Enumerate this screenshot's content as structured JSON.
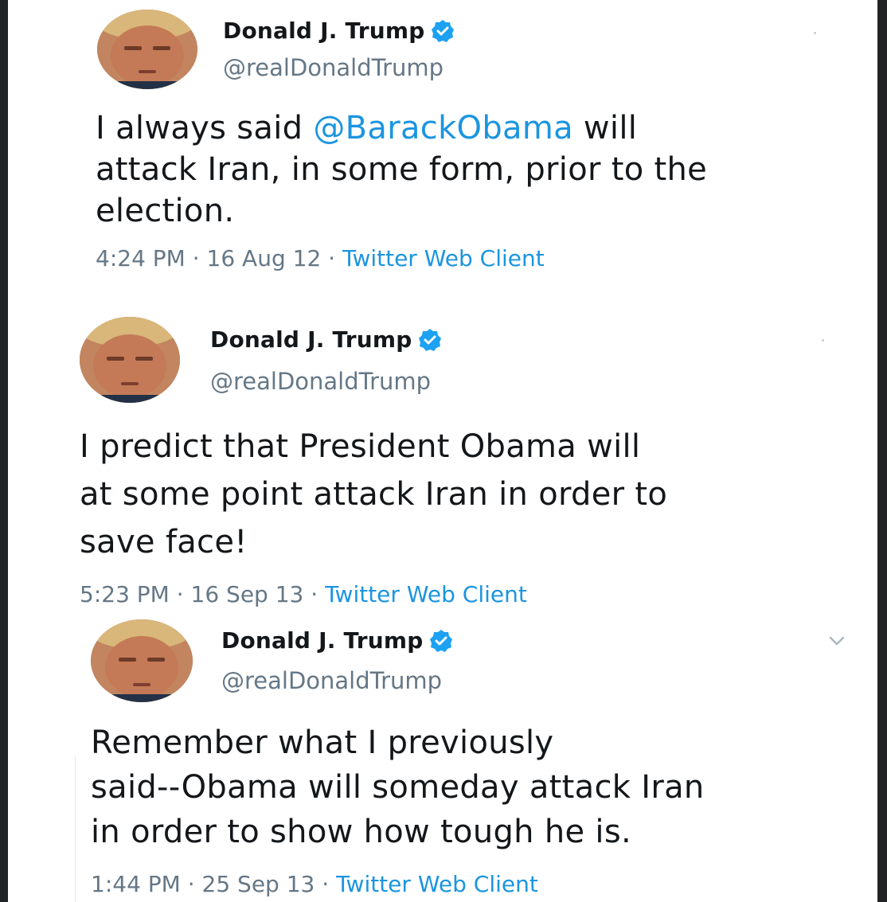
{
  "tweets": [
    {
      "author": {
        "name": "Donald J. Trump",
        "handle": "@realDonaldTrump",
        "avatar_icon": "profile-photo",
        "verified_icon": "verified-badge-icon"
      },
      "lines": [
        {
          "before": "I always said ",
          "mention": "@BarackObama",
          "after": " will"
        },
        {
          "before": "attack Iran, in some form, prior to the",
          "mention": "",
          "after": ""
        },
        {
          "before": "election.",
          "mention": "",
          "after": ""
        }
      ],
      "time": "4:24 PM",
      "date": "16 Aug 12",
      "separator": " · ",
      "source": "Twitter Web Client"
    },
    {
      "author": {
        "name": "Donald J. Trump",
        "handle": "@realDonaldTrump",
        "avatar_icon": "profile-photo",
        "verified_icon": "verified-badge-icon"
      },
      "lines": [
        {
          "before": "I predict that President Obama will",
          "mention": "",
          "after": ""
        },
        {
          "before": "at some point attack Iran in order to",
          "mention": "",
          "after": ""
        },
        {
          "before": "save face!",
          "mention": "",
          "after": ""
        }
      ],
      "time": "5:23 PM",
      "date": "16 Sep 13",
      "separator": " · ",
      "source": "Twitter Web Client"
    },
    {
      "author": {
        "name": "Donald J. Trump",
        "handle": "@realDonaldTrump",
        "avatar_icon": "profile-photo",
        "verified_icon": "verified-badge-icon"
      },
      "lines": [
        {
          "before": "Remember what I previously",
          "mention": "",
          "after": ""
        },
        {
          "before": "said--Obama will someday attack Iran",
          "mention": "",
          "after": ""
        },
        {
          "before": "in order to show how tough he is.",
          "mention": "",
          "after": ""
        }
      ],
      "time": "1:44 PM",
      "date": "25 Sep 13",
      "separator": " · ",
      "source": "Twitter Web Client",
      "menu_icon": "chevron-down-icon"
    }
  ],
  "colors": {
    "background_outer": "#222324",
    "card": "#ffffff",
    "text": "#14171a",
    "secondary": "#657786",
    "link": "#1b95e0"
  }
}
